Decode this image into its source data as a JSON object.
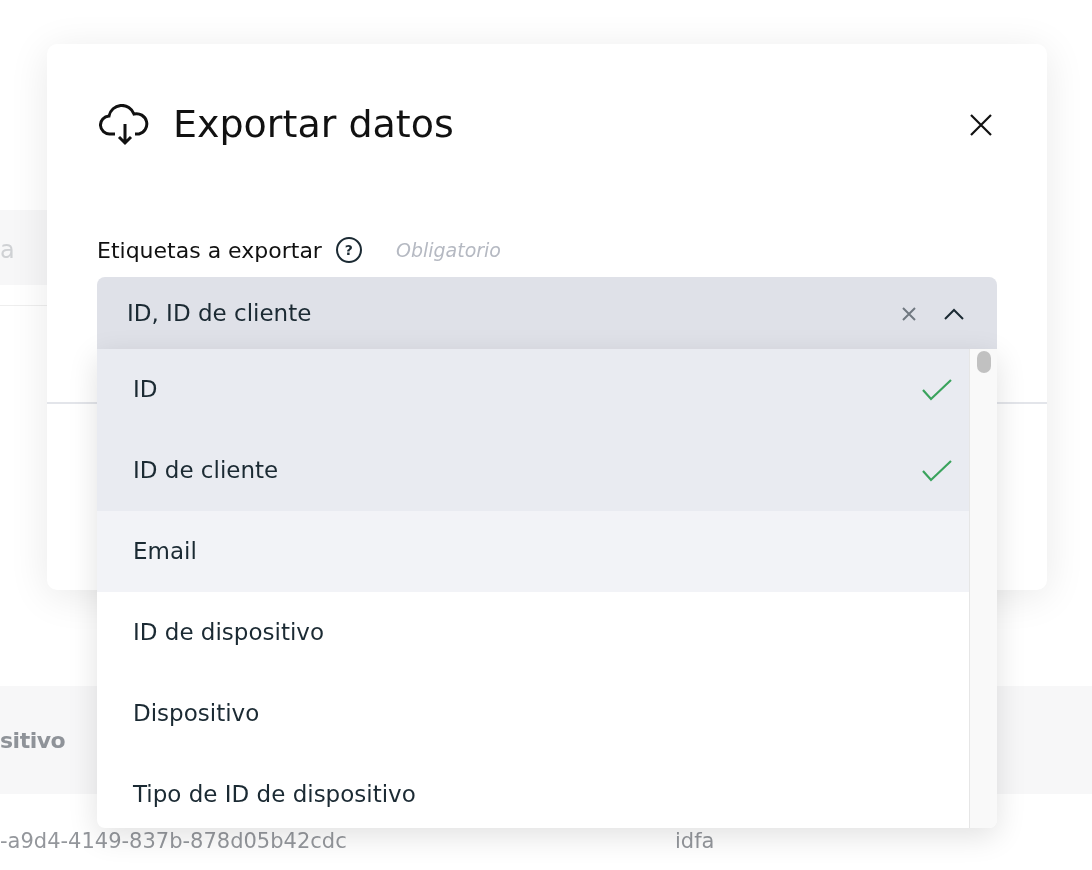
{
  "background": {
    "search_text": "a",
    "table_header": "sitivo",
    "table_row": [
      "-a9d4-4149-837b-878d05b42cdc",
      "idfa"
    ]
  },
  "dialog": {
    "title": "Exportar datos",
    "field": {
      "label": "Etiquetas a exportar",
      "help": "?",
      "hint": "Obligatorio",
      "value": "ID, ID de cliente",
      "expanded": true
    },
    "options": [
      {
        "label": "ID",
        "checked": true,
        "highlighted": false
      },
      {
        "label": "ID de cliente",
        "checked": true,
        "highlighted": false
      },
      {
        "label": "Email",
        "checked": false,
        "highlighted": true
      },
      {
        "label": "ID de dispositivo",
        "checked": false,
        "highlighted": false
      },
      {
        "label": "Dispositivo",
        "checked": false,
        "highlighted": false
      },
      {
        "label": "Tipo de ID de dispositivo",
        "checked": false,
        "highlighted": false
      }
    ]
  }
}
